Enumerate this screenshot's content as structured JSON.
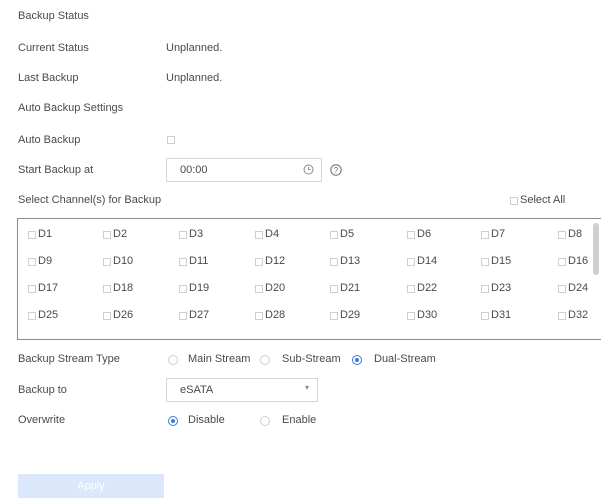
{
  "sections": {
    "backup_status": "Backup Status",
    "auto_backup_settings": "Auto Backup Settings"
  },
  "status": {
    "current_label": "Current Status",
    "current_value": "Unplanned.",
    "last_label": "Last Backup",
    "last_value": "Unplanned."
  },
  "auto": {
    "auto_backup_label": "Auto Backup",
    "auto_backup_checked": false,
    "start_label": "Start Backup at",
    "start_value": "00:00"
  },
  "channels": {
    "label": "Select Channel(s) for Backup",
    "select_all": "Select All",
    "items": [
      "D1",
      "D2",
      "D3",
      "D4",
      "D5",
      "D6",
      "D7",
      "D8",
      "D9",
      "D10",
      "D11",
      "D12",
      "D13",
      "D14",
      "D15",
      "D16",
      "D17",
      "D18",
      "D19",
      "D20",
      "D21",
      "D22",
      "D23",
      "D24",
      "D25",
      "D26",
      "D27",
      "D28",
      "D29",
      "D30",
      "D31",
      "D32"
    ]
  },
  "stream": {
    "label": "Backup Stream Type",
    "options": [
      "Main Stream",
      "Sub-Stream",
      "Dual-Stream"
    ],
    "selected": "Dual-Stream"
  },
  "backup_to": {
    "label": "Backup to",
    "value": "eSATA"
  },
  "overwrite": {
    "label": "Overwrite",
    "options": [
      "Disable",
      "Enable"
    ],
    "selected": "Disable"
  },
  "apply_label": "Apply",
  "colors": {
    "accent": "#3b7bdd",
    "apply_bg": "#dbe8fb"
  }
}
